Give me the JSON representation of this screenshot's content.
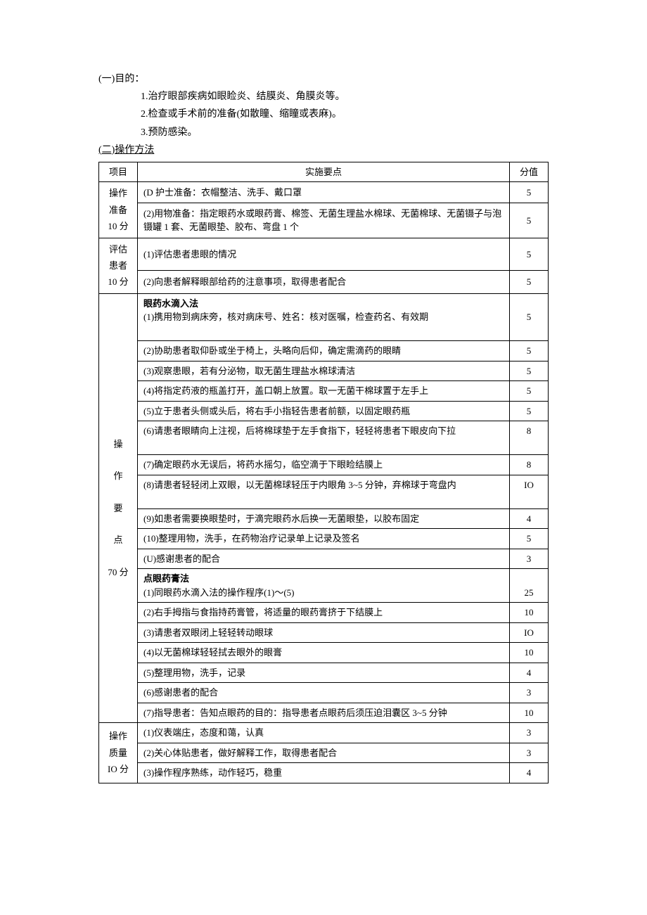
{
  "intro": {
    "heading1": "(一)目的：",
    "item1": "1.治疗眼部疾病如眼睑炎、结膜炎、角膜炎等。",
    "item2": "2.检查或手术前的准备(如散瞳、缩瞳或表麻)。",
    "item3": "3.预防感染。",
    "heading2": "(二)操作方法"
  },
  "header": {
    "c1": "项目",
    "c2": "实施要点",
    "c3": "分值"
  },
  "sections": {
    "s1": {
      "label_l1": "操作",
      "label_l2": "准备",
      "label_l3": "10 分",
      "rows": [
        {
          "desc": "(D 护士准备：衣帽整洁、洗手、戴口罩",
          "score": "5"
        },
        {
          "desc": "(2)用物准备：指定眼药水或眼药膏、棉签、无菌生理盐水棉球、无菌棉球、无菌镊子与泡镊罐 1 套、无菌眼垫、胶布、弯盘 1 个",
          "score": "5"
        }
      ]
    },
    "s2": {
      "label_l1": "评估",
      "label_l2": "患者",
      "label_l3": "10 分",
      "rows": [
        {
          "desc": "(1)评估患者患眼的情况",
          "score": "5"
        },
        {
          "desc": "(2)向患者解释眼部给药的注意事项，取得患者配合",
          "score": "5"
        }
      ]
    },
    "s3": {
      "label_l1": "操",
      "label_l2": "作",
      "label_l3": "要",
      "label_l4": "点",
      "label_l5": "70 分",
      "rows": [
        {
          "desc1": "眼药水滴入法",
          "desc2": "(1)携用物到病床旁，核对病床号、姓名：核对医嘱，检查药名、有效期",
          "score": "5"
        },
        {
          "desc": "(2)协助患者取仰卧或坐于椅上，头略向后仰，确定需滴药的眼睛",
          "score": "5"
        },
        {
          "desc": "(3)观察患眼，若有分泌物，取无菌生理盐水棉球清洁",
          "score": "5"
        },
        {
          "desc": "(4)将指定药液的瓶盖打开，盖口朝上放置。取一无菌干棉球置于左手上",
          "score": "5"
        },
        {
          "desc": "(5)立于患者头侧或头后，将右手小指轻告患者前额，以固定眼药瓶",
          "score": "5"
        },
        {
          "desc": "(6)请患者眼睛向上注视，后将棉球垫于左手食指下，轻轻将患者下眼皮向下拉",
          "score": "8"
        },
        {
          "desc": "(7)确定眼药水无误后，将药水摇匀，临空滴于下眼睑结膜上",
          "score": "8"
        },
        {
          "desc": "(8)请患者轻轻闭上双眼，以无菌棉球轻压于内眼角 3~5 分钟，弃棉球于弯盘内",
          "score": "IO"
        },
        {
          "desc": "(9)如患者需要换眼垫时，于滴完眼药水后换一无菌眼垫，以胶布固定",
          "score": "4"
        },
        {
          "desc": "(10)整理用物，洗手，在药物治疗记录单上记录及签名",
          "score": "5"
        },
        {
          "desc": "(U)感谢患者的配合",
          "score": "3"
        },
        {
          "desc1": "点眼药膏法",
          "desc2": "(1)同眼药水滴入法的操作程序(1)～(5)",
          "score": "25"
        },
        {
          "desc": "(2)右手拇指与食指持药膏管，将适量的眼药膏挤于下结膜上",
          "score": "10"
        },
        {
          "desc": "(3)请患者双眼闭上轻轻转动眼球",
          "score": "IO"
        },
        {
          "desc": "(4)以无菌棉球轻轻拭去眼外的眼膏",
          "score": "10"
        },
        {
          "desc": "(5)整理用物，洗手，记录",
          "score": "4"
        },
        {
          "desc": "(6)感谢患者的配合",
          "score": "3"
        },
        {
          "desc": "(7)指导患者：告知点眼药的目的：指导患者点眼药后须压迫泪囊区 3~5 分钟",
          "score": "10"
        }
      ]
    },
    "s4": {
      "label_l1": "操作",
      "label_l2": "质量",
      "label_l3": "IO 分",
      "rows": [
        {
          "desc": "(1)仪表端庄，态度和蔼，认真",
          "score": "3"
        },
        {
          "desc": "(2)关心体贴患者，做好解释工作，取得患者配合",
          "score": "3"
        },
        {
          "desc": "(3)操作程序熟练，动作轻巧，稳重",
          "score": "4"
        }
      ]
    }
  }
}
